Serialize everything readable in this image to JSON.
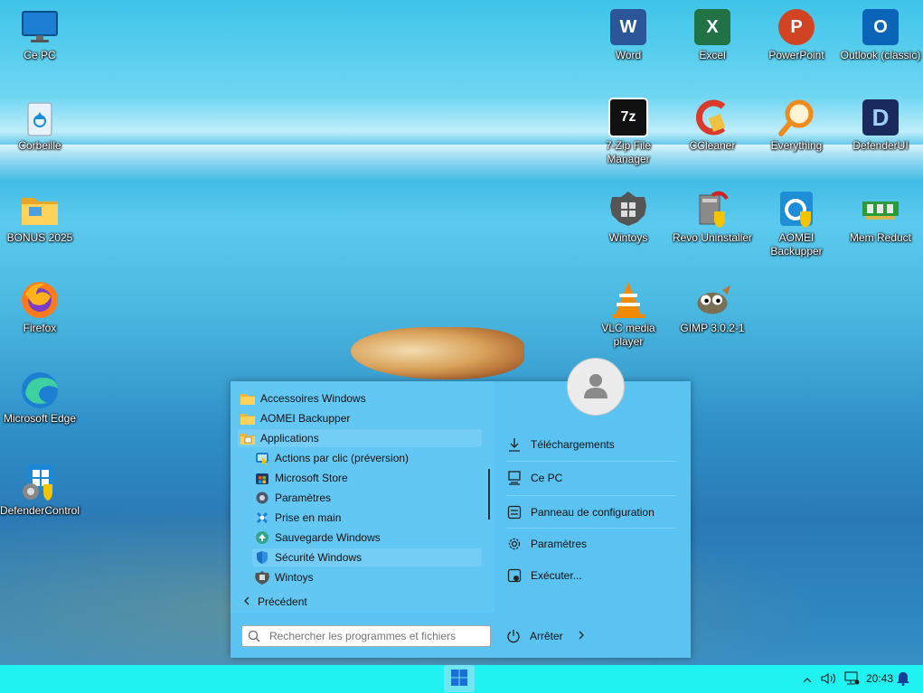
{
  "desktop": {
    "left_icons": [
      {
        "label": "Ce PC",
        "icon": "monitor-icon"
      },
      {
        "label": "Corbeille",
        "icon": "recycle-bin-icon"
      },
      {
        "label": "BONUS 2025",
        "icon": "folder-icon"
      },
      {
        "label": "Firefox",
        "icon": "firefox-icon"
      },
      {
        "label": "Microsoft Edge",
        "icon": "edge-icon"
      },
      {
        "label": "DefenderControl",
        "icon": "defender-control-icon"
      }
    ],
    "right_icons": [
      {
        "label": "Word",
        "icon": "word-icon",
        "glyph": "W",
        "color": "#2b579a"
      },
      {
        "label": "Excel",
        "icon": "excel-icon",
        "glyph": "X",
        "color": "#217346"
      },
      {
        "label": "PowerPoint",
        "icon": "powerpoint-icon",
        "glyph": "P",
        "color": "#d04423"
      },
      {
        "label": "Outlook (classic)",
        "icon": "outlook-icon",
        "glyph": "O",
        "color": "#0a64b8"
      },
      {
        "label": "7-Zip File Manager",
        "icon": "7zip-icon",
        "glyph": "7z",
        "color": "#111111"
      },
      {
        "label": "CCleaner",
        "icon": "ccleaner-icon",
        "glyph": "C",
        "color": "#d93a2b"
      },
      {
        "label": "Everything",
        "icon": "everything-search-icon",
        "glyph": "",
        "color": "#f08a1a"
      },
      {
        "label": "DefenderUI",
        "icon": "defenderui-icon",
        "glyph": "D",
        "color": "#1b2a5c"
      },
      {
        "label": "Wintoys",
        "icon": "wintoys-icon",
        "glyph": "",
        "color": "#555555"
      },
      {
        "label": "Revo Uninstaller",
        "icon": "revo-uninstaller-icon",
        "glyph": "",
        "color": "#8a8a8a"
      },
      {
        "label": "AOMEI Backupper",
        "icon": "aomei-backupper-icon",
        "glyph": "",
        "color": "#1e8fd6"
      },
      {
        "label": "Mem Reduct",
        "icon": "mem-reduct-icon",
        "glyph": "",
        "color": "#2d9a3a"
      },
      {
        "label": "VLC media player",
        "icon": "vlc-icon",
        "glyph": "",
        "color": "#f28a00"
      },
      {
        "label": "GIMP 3.0.2-1",
        "icon": "gimp-icon",
        "glyph": "",
        "color": "#6f6650"
      }
    ]
  },
  "start_menu": {
    "left_items": [
      {
        "label": "Accessoires Windows",
        "icon": "folder-icon",
        "sub": false
      },
      {
        "label": "AOMEI Backupper",
        "icon": "folder-icon",
        "sub": false
      },
      {
        "label": "Applications",
        "icon": "applications-folder-icon",
        "sub": false
      },
      {
        "label": "Actions par clic (préversion)",
        "icon": "click-actions-icon",
        "sub": true
      },
      {
        "label": "Microsoft Store",
        "icon": "store-icon",
        "sub": true
      },
      {
        "label": "Paramètres",
        "icon": "settings-gear-icon",
        "sub": true
      },
      {
        "label": "Prise en main",
        "icon": "get-started-icon",
        "sub": true
      },
      {
        "label": "Sauvegarde Windows",
        "icon": "backup-icon",
        "sub": true
      },
      {
        "label": "Sécurité Windows",
        "icon": "shield-icon",
        "sub": true
      },
      {
        "label": "Wintoys",
        "icon": "wintoys-icon",
        "sub": true
      }
    ],
    "back_label": "Précédent",
    "right_items": [
      {
        "label": "Téléchargements",
        "icon": "download-icon"
      },
      {
        "label": "Ce PC",
        "icon": "computer-icon"
      },
      {
        "label": "Panneau de configuration",
        "icon": "control-panel-icon"
      },
      {
        "label": "Paramètres",
        "icon": "settings-gear-icon"
      },
      {
        "label": "Exécuter...",
        "icon": "run-icon"
      }
    ],
    "search_placeholder": "Rechercher les programmes et fichiers",
    "shutdown_label": "Arrêter"
  },
  "taskbar": {
    "time": "20:43"
  }
}
